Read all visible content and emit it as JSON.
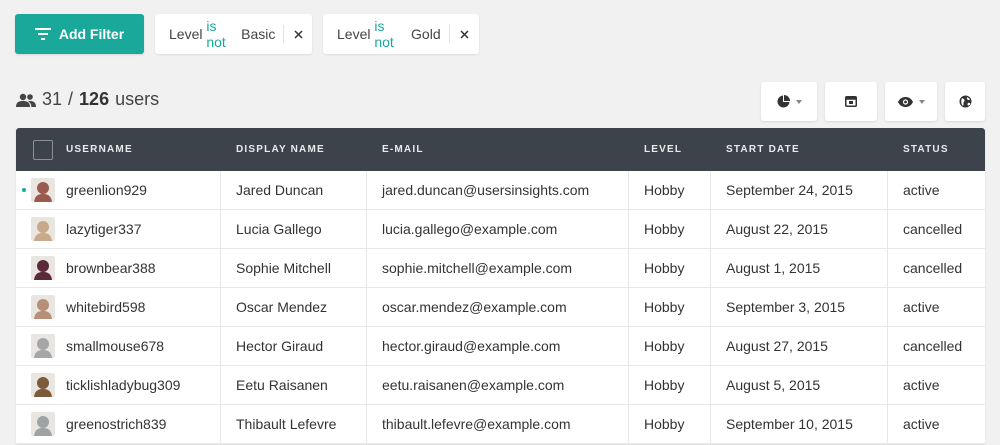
{
  "filters": {
    "add_label": "Add Filter",
    "chips": [
      {
        "field": "Level",
        "op": "is not",
        "value": "Basic"
      },
      {
        "field": "Level",
        "op": "is not",
        "value": "Gold"
      }
    ]
  },
  "count": {
    "shown": "31",
    "sep": "/",
    "total": "126",
    "unit": "users"
  },
  "toolbar": {
    "icons": [
      "pie-chart-icon",
      "layout-icon",
      "eye-icon",
      "globe-icon"
    ]
  },
  "table": {
    "headers": [
      "USERNAME",
      "DISPLAY NAME",
      "E-MAIL",
      "LEVEL",
      "START DATE",
      "STATUS"
    ],
    "rows": [
      {
        "username": "greenlion929",
        "display": "Jared Duncan",
        "email": "jared.duncan@usersinsights.com",
        "level": "Hobby",
        "date": "September 24, 2015",
        "status": "active",
        "avatar": "#9a5a4e"
      },
      {
        "username": "lazytiger337",
        "display": "Lucia Gallego",
        "email": "lucia.gallego@example.com",
        "level": "Hobby",
        "date": "August 22, 2015",
        "status": "cancelled",
        "avatar": "#c9a989"
      },
      {
        "username": "brownbear388",
        "display": "Sophie Mitchell",
        "email": "sophie.mitchell@example.com",
        "level": "Hobby",
        "date": "August 1, 2015",
        "status": "cancelled",
        "avatar": "#5b2a3a"
      },
      {
        "username": "whitebird598",
        "display": "Oscar Mendez",
        "email": "oscar.mendez@example.com",
        "level": "Hobby",
        "date": "September 3, 2015",
        "status": "active",
        "avatar": "#b78f78"
      },
      {
        "username": "smallmouse678",
        "display": "Hector Giraud",
        "email": "hector.giraud@example.com",
        "level": "Hobby",
        "date": "August 27, 2015",
        "status": "cancelled",
        "avatar": "#a4a6a8"
      },
      {
        "username": "ticklishladybug309",
        "display": "Eetu Raisanen",
        "email": "eetu.raisanen@example.com",
        "level": "Hobby",
        "date": "August 5, 2015",
        "status": "active",
        "avatar": "#7c5a3c"
      },
      {
        "username": "greenostrich839",
        "display": "Thibault Lefevre",
        "email": "thibault.lefevre@example.com",
        "level": "Hobby",
        "date": "September 10, 2015",
        "status": "active",
        "avatar": "#9ea3a3"
      }
    ]
  }
}
